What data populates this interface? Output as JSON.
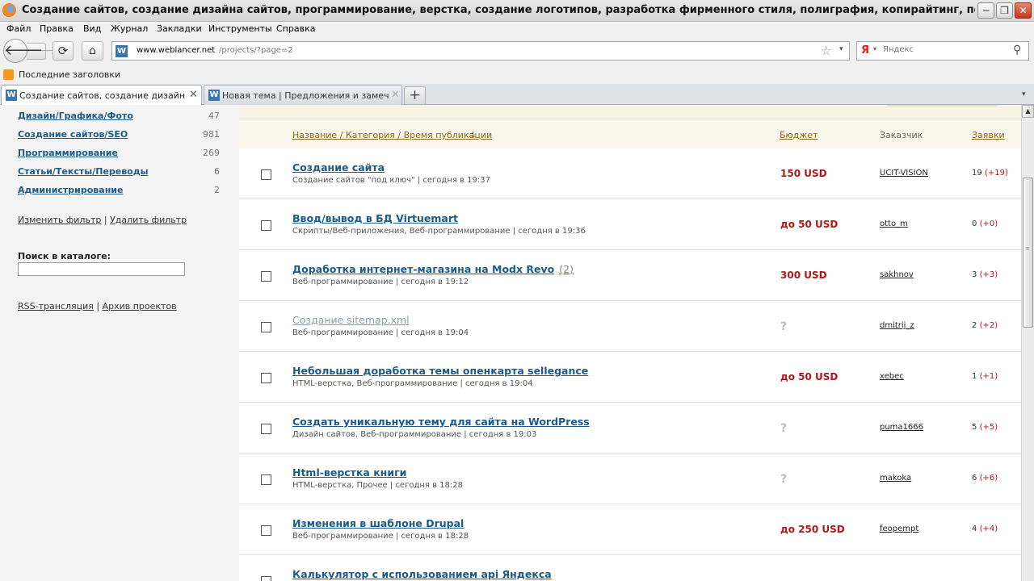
{
  "window": {
    "title": "Создание сайтов, создание дизайна сайтов, программирование, верстка, создание логотипов, разработка фирменного стиля, полиграфия, копирайтинг, перевод, оптимизация. — ...",
    "minimize": "−",
    "maximize": "❐",
    "close": "✕"
  },
  "menu": [
    "Файл",
    "Правка",
    "Вид",
    "Журнал",
    "Закладки",
    "Инструменты",
    "Справка"
  ],
  "nav": {
    "back": "🡐",
    "forward": "🡒",
    "reload": "⟳",
    "home": "⌂",
    "site_icon": "W",
    "url_host": "www.weblancer.net",
    "url_path": "/projects/?page=2",
    "star": "☆",
    "dropdown": "▾"
  },
  "search": {
    "engine_icon": "Я",
    "dropdown": "▾",
    "placeholder": "Яндекс",
    "go": "⚲"
  },
  "bookmarks": {
    "item": "Последние заголовки"
  },
  "tabs": [
    {
      "label": "Создание сайтов, создание дизайна с...",
      "icon": "W",
      "close": "✕"
    },
    {
      "label": "Новая тема | Предложения и замечани...",
      "icon": "W",
      "close": "✕"
    }
  ],
  "new_tab": "+",
  "tab_list": "▾",
  "sidebar": {
    "categories": [
      {
        "name": "Дизайн/Графика/Фото",
        "count": "47"
      },
      {
        "name": "Создание сайтов/SEO",
        "count": "981"
      },
      {
        "name": "Программирование",
        "count": "269"
      },
      {
        "name": "Статьи/Тексты/Переводы",
        "count": "6"
      },
      {
        "name": "Администрирование",
        "count": "2"
      }
    ],
    "change_filter": "Изменить фильтр",
    "delete_filter": "Удалить фильтр",
    "separator": "|",
    "search_label": "Поиск в каталоге:",
    "rss": "RSS-трансляция",
    "archive": "Архив проектов"
  },
  "table": {
    "headers": {
      "title": "Название / Категория / Время публикации",
      "sort_arrow": "↓",
      "budget": "Бюджет",
      "customer": "Заказчик",
      "bids": "Заявки"
    },
    "rows": [
      {
        "title": "Создание сайта",
        "extra": "",
        "meta": "Создание сайтов \"под ключ\" | сегодня в 19:37",
        "budget": "150 USD",
        "customer": "UCIT-VISION",
        "bids": "19",
        "bids_new": "(+19)"
      },
      {
        "title": "Ввод/вывод в БД Virtuemart",
        "extra": "",
        "meta": "Скрипты/Веб-приложения, Веб-программирование | сегодня в 19:36",
        "budget": "до 50 USD",
        "customer": "otto_m",
        "bids": "0",
        "bids_new": "(+0)"
      },
      {
        "title": "Доработка интернет-магазина на Modx Revo",
        "extra": "(2)",
        "meta": "Веб-программирование | сегодня в 19:12",
        "budget": "300 USD",
        "customer": "sakhnov",
        "bids": "3",
        "bids_new": "(+3)"
      },
      {
        "title": "Создание sitemap.xml",
        "extra": "",
        "meta": "Веб-программирование | сегодня в 19:04",
        "budget": "?",
        "customer": "dmitrij_z",
        "bids": "2",
        "bids_new": "(+2)"
      },
      {
        "title": "Небольшая доработка темы опенкарта sellegance",
        "extra": "",
        "meta": "HTML-верстка, Веб-программирование | сегодня в 19:04",
        "budget": "до 50 USD",
        "customer": "xebec",
        "bids": "1",
        "bids_new": "(+1)"
      },
      {
        "title": "Создать уникальную тему для сайта на WordPress",
        "extra": "",
        "meta": "Дизайн сайтов, Веб-программирование | сегодня в 19:03",
        "budget": "?",
        "customer": "puma1666",
        "bids": "5",
        "bids_new": "(+5)"
      },
      {
        "title": "Html-верстка книги",
        "extra": "",
        "meta": "HTML-верстка, Прочее | сегодня в 18:28",
        "budget": "?",
        "customer": "makoka",
        "bids": "6",
        "bids_new": "(+6)"
      },
      {
        "title": "Изменения в шаблоне Drupal",
        "extra": "",
        "meta": "Веб-программирование | сегодня в 18:28",
        "budget": "до 250 USD",
        "customer": "feopempt",
        "bids": "4",
        "bids_new": "(+4)"
      },
      {
        "title": "Калькулятор с использованием api Яндекса",
        "extra": "",
        "meta": "",
        "budget": "",
        "customer": "",
        "bids": "",
        "bids_new": ""
      }
    ]
  },
  "scroll": {
    "up": "▲",
    "grip": "≡"
  }
}
